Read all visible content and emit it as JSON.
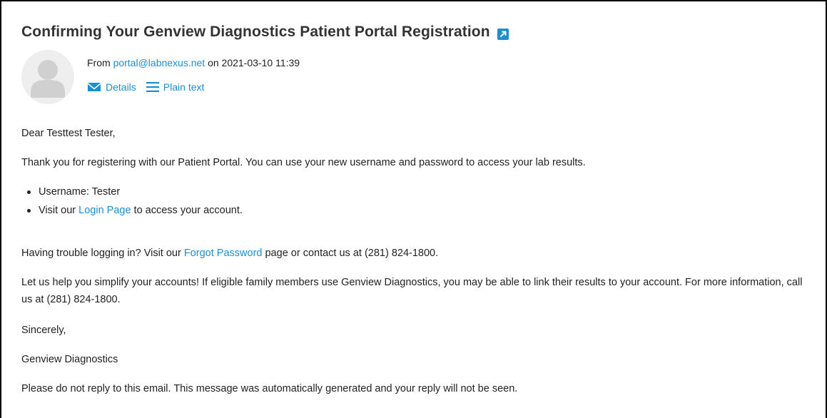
{
  "email": {
    "subject": "Confirming Your Genview Diagnostics Patient Portal Registration",
    "from_prefix": "From ",
    "from_address": "portal@labnexus.net",
    "date_text": " on 2021-03-10 11:39",
    "actions": {
      "details_label": "Details",
      "plain_text_label": "Plain text"
    }
  },
  "body": {
    "greeting": "Dear Testtest Tester,",
    "thanks": "Thank you for registering with our Patient Portal. You can use your new username and password to access your lab results.",
    "list": {
      "username": "Username: Tester",
      "visit_prefix": "Visit our ",
      "login_link": "Login Page",
      "visit_suffix": " to access your account."
    },
    "trouble": {
      "prefix": "Having trouble logging in? Visit our ",
      "link": "Forgot Password",
      "suffix": " page or contact us at (281) 824-1800."
    },
    "simplify": "Let us help you simplify your accounts! If eligible family members use Genview Diagnostics, you may be able to link their results to your account. For more information, call us at (281) 824-1800.",
    "sincerely": "Sincerely,",
    "signoff": "Genview Diagnostics",
    "noreply": "Please do not reply to this email. This message was automatically generated and your reply will not be seen."
  },
  "colors": {
    "link": "#1a8fd6",
    "text": "#222222",
    "avatar_bg": "#eeeeee",
    "avatar_fg": "#d0d0d0"
  },
  "icons": {
    "external": "external-link-icon",
    "avatar": "user-avatar-icon",
    "details": "envelope-icon",
    "plain_text": "lines-icon"
  }
}
